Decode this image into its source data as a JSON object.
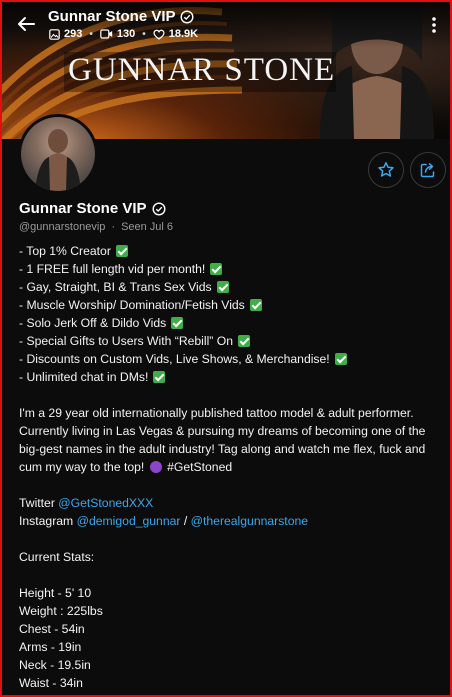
{
  "header": {
    "title": "Gunnar Stone VIP",
    "stats": {
      "media": "293",
      "videos": "130",
      "likes": "18.9K"
    },
    "banner_text": "GUNNAR STONE"
  },
  "profile": {
    "name": "Gunnar Stone VIP",
    "handle": "@gunnarstonevip",
    "separator": "·",
    "seen": "Seen  Jul 6"
  },
  "bio": {
    "checklist": [
      "- Top 1% Creator",
      "- 1 FREE full length vid per month!",
      "- Gay, Straight, BI & Trans Sex Vids",
      "- Muscle Worship/ Domination/Fetish Vids",
      "- Solo Jerk Off & Dildo Vids",
      "- Special Gifts to Users With “Rebill” On",
      "- Discounts on Custom Vids, Live Shows, & Merchandise!",
      "- Unlimited chat in DMs!"
    ],
    "about": "I'm a 29 year old internationally published tattoo model & adult performer. Currently living in Las Vegas & pursuing my dreams of becoming one of the big-gest names in the adult industry! Tag along and watch me flex, fuck and cum my way to the top!",
    "hashtag": "#GetStoned",
    "twitter_label": "Twitter",
    "twitter_link": "@GetStonedXXX",
    "instagram_label": "Instagram",
    "instagram_link1": "@demigod_gunnar",
    "instagram_sep": " / ",
    "instagram_link2": "@therealgunnarstone",
    "stats_heading": "Current Stats:",
    "stats": [
      "Height - 5' 10",
      "Weight : 225lbs",
      "Chest - 54in",
      "Arms - 19in",
      "Neck - 19.5in",
      "Waist - 34in"
    ]
  },
  "colors": {
    "accent": "#3aa7f0",
    "check": "#3fae49",
    "frame": "#e01010"
  },
  "icons": [
    "back-arrow-icon",
    "verified-icon",
    "image-icon",
    "video-icon",
    "heart-icon",
    "more-vertical-icon",
    "star-icon",
    "share-icon"
  ]
}
